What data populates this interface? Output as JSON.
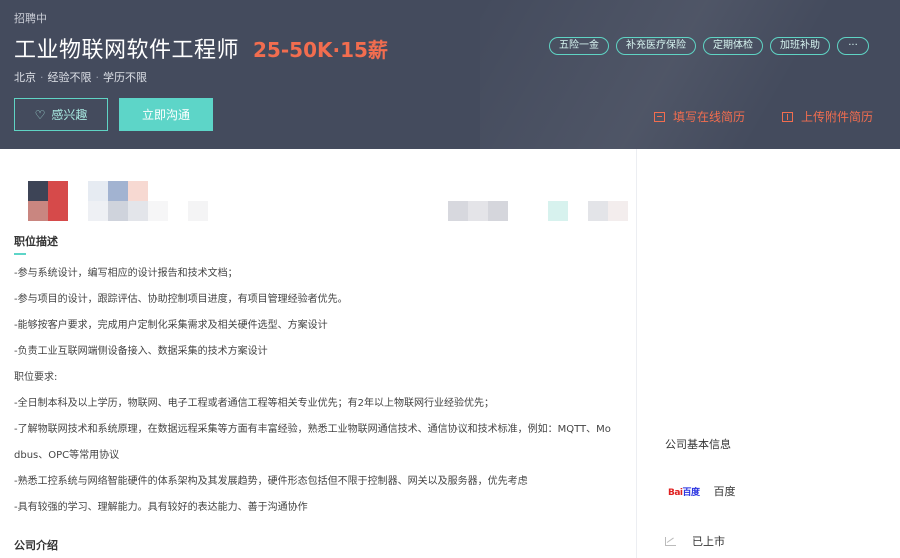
{
  "header": {
    "status": "招聘中",
    "job_title": "工业物联网软件工程师",
    "salary": "25-50K·15薪",
    "location": "北京",
    "experience": "经验不限",
    "education": "学历不限",
    "sep": "·",
    "tags": [
      "五险一金",
      "补充医疗保险",
      "定期体检",
      "加班补助",
      "···"
    ],
    "interest_label": "感兴趣",
    "chat_label": "立即沟通",
    "online_resume_label": "填写在线简历",
    "upload_resume_label": "上传附件简历"
  },
  "main": {
    "job_desc_title": "职位描述",
    "lines": [
      "-参与系统设计，编写相应的设计报告和技术文档；",
      "-参与项目的设计，跟踪评估、协助控制项目进度，有项目管理经验者优先。",
      "-能够按客户要求，完成用户定制化采集需求及相关硬件选型、方案设计",
      "-负责工业互联网端侧设备接入、数据采集的技术方案设计",
      "职位要求:",
      "-全日制本科及以上学历，物联网、电子工程或者通信工程等相关专业优先；有2年以上物联网行业经验优先；",
      "-了解物联网技术和系统原理，在数据远程采集等方面有丰富经验，熟悉工业物联网通信技术、通信协议和技术标准，例如：MQTT、Mo",
      "dbus、OPC等常用协议",
      "-熟悉工控系统与网络智能硬件的体系架构及其发展趋势，硬件形态包括但不限于控制器、网关以及服务器，优先考虑",
      "-具有较强的学习、理解能力。具有较好的表达能力、善于沟通协作"
    ],
    "company_intro_title": "公司介绍"
  },
  "sidebar": {
    "title": "公司基本信息",
    "logo_text_a": "Bai",
    "logo_text_b": "百度",
    "company_name": "百度",
    "listed_label": "已上市"
  },
  "colors": {
    "header_bg": "#444b5d",
    "accent": "#5dd5c8",
    "salary": "#f26d4f"
  }
}
